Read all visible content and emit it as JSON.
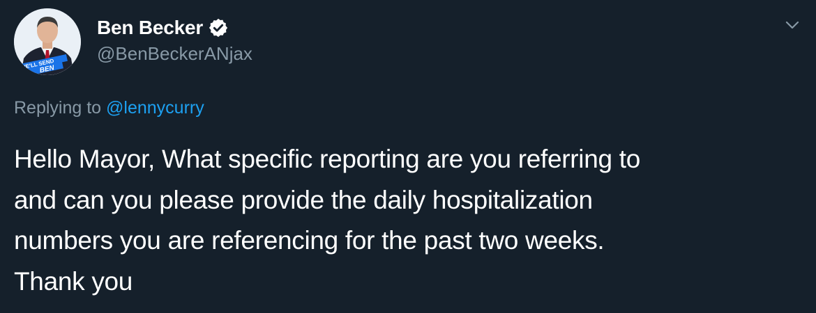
{
  "author": {
    "display_name": "Ben Becker",
    "handle": "@BenBeckerANjax",
    "verified": true,
    "avatar_badge_line1": "WE'LL SEND",
    "avatar_badge_line2": "BEN"
  },
  "reply": {
    "prefix": "Replying to ",
    "mention": "@lennycurry"
  },
  "tweet": {
    "text": "Hello Mayor, What specific reporting are you referring to\nand can you please provide the daily hospitalization\nnumbers you are referencing for the past two weeks.\nThank you"
  },
  "icons": {
    "verified": "verified-badge-icon",
    "menu": "chevron-down-icon"
  },
  "colors": {
    "background": "#15202b",
    "text_primary": "#ffffff",
    "text_secondary": "#8899a6",
    "link": "#1da1f2"
  }
}
